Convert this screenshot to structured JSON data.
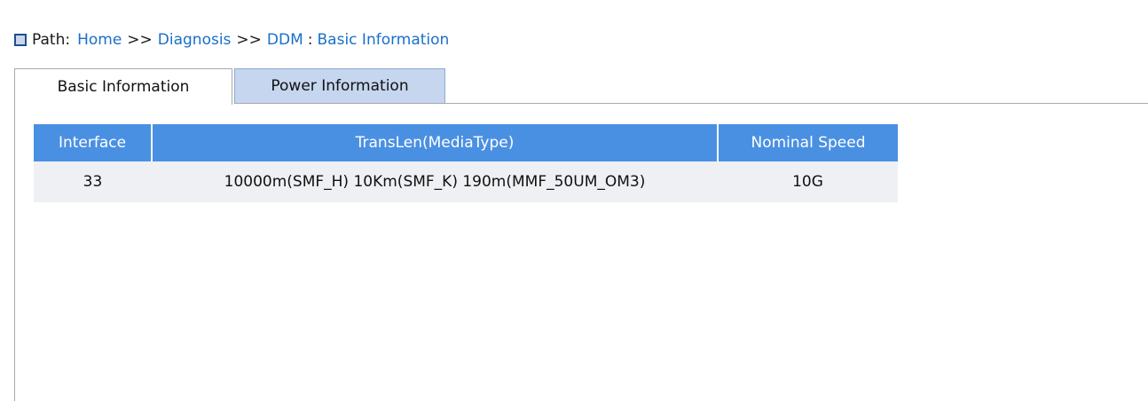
{
  "breadcrumb": {
    "label": "Path:",
    "items": [
      "Home",
      "Diagnosis",
      "DDM"
    ],
    "separator": ">>",
    "current": "Basic Information"
  },
  "tabs": [
    {
      "label": "Basic Information",
      "active": true
    },
    {
      "label": "Power Information",
      "active": false
    }
  ],
  "table": {
    "headers": [
      "Interface",
      "TransLen(MediaType)",
      "Nominal Speed"
    ],
    "rows": [
      {
        "interface": "33",
        "translen": "10000m(SMF_H) 10Km(SMF_K) 190m(MMF_50UM_OM3)",
        "speed": "10G"
      }
    ]
  },
  "colors": {
    "link": "#1a6fc9",
    "header_bg": "#4a90e2",
    "row_bg": "#eef0f3",
    "inactive_tab_bg": "#c5d6ee"
  }
}
